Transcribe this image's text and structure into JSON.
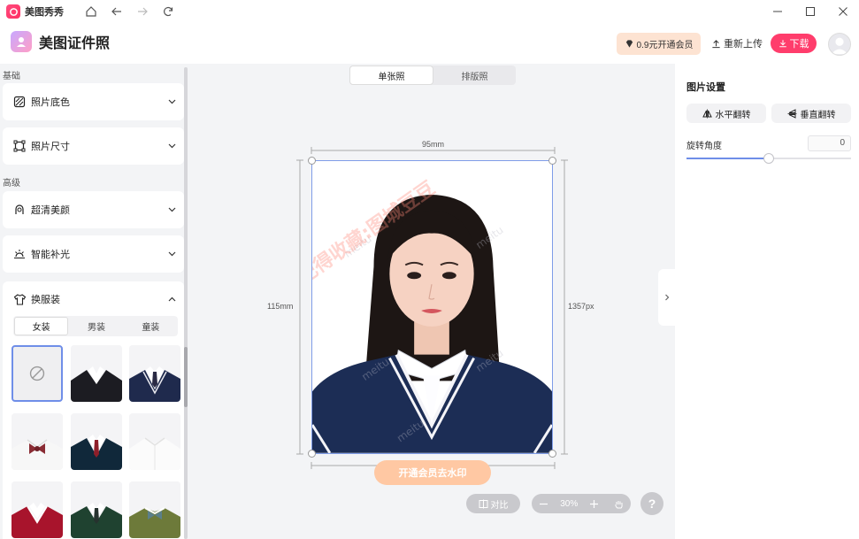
{
  "titlebar": {
    "app_name": "美图秀秀"
  },
  "header": {
    "title": "美图证件照",
    "vip_label": "0.9元开通会员",
    "reupload_label": "重新上传",
    "download_label": "下载"
  },
  "left": {
    "basic_label": "基础",
    "advanced_label": "高级",
    "items": {
      "bg_color": "照片底色",
      "size": "照片尺寸",
      "beauty": "超清美颜",
      "light": "智能补光"
    },
    "clothes": {
      "title": "换服装",
      "tabs": [
        "女装",
        "男装",
        "童装"
      ],
      "active_tab": "女装"
    }
  },
  "center": {
    "tabs": [
      "单张照",
      "排版照"
    ],
    "active_tab": "单张照",
    "width_label": "95mm",
    "height_label": "115mm",
    "px_label": "1357px",
    "remove_watermark": "开通会员去水印",
    "compare_label": "对比",
    "zoom": "30%",
    "help": "?",
    "watermark_text": "记得收藏:图城豆豆"
  },
  "right": {
    "title": "图片设置",
    "hflip_label": "水平翻转",
    "vflip_label": "垂直翻转",
    "rotation_label": "旋转角度",
    "rotation_value": "0",
    "slider_fraction": 0.5
  },
  "colors": {
    "accent_pink": "#ff3d6c",
    "accent_blue": "#6f8ee8",
    "vip_bg": "#fde3d2",
    "watermark_orange": "#ffc8a3"
  }
}
